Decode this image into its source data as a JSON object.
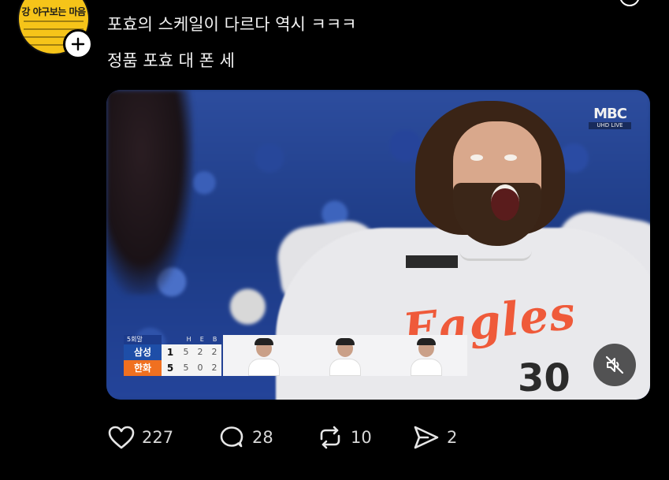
{
  "post": {
    "text_line1": "포효의 스케일이 다르다 역시 ㅋㅋㅋ",
    "text_line2": "정품 포효 대 폰 세"
  },
  "author": {
    "avatar_text": "강 야구보는 마음"
  },
  "media": {
    "broadcaster": "MBC",
    "broadcaster_sub": "UHD LIVE",
    "jersey_wordmark": "Eagles",
    "jersey_number": "30",
    "scoreboard": {
      "inning": "5회말",
      "stat_headers": [
        "H",
        "E",
        "B"
      ],
      "teams": [
        {
          "name": "삼성",
          "runs": "1",
          "stats": [
            "5",
            "2",
            "2"
          ]
        },
        {
          "name": "한화",
          "runs": "5",
          "stats": [
            "5",
            "0",
            "2"
          ]
        }
      ]
    },
    "muted": true
  },
  "actions": {
    "likes": "227",
    "comments": "28",
    "reposts": "10",
    "shares": "2"
  },
  "colors": {
    "background": "#000000",
    "home_team": "#1e4ea8",
    "away_team": "#f07020",
    "jersey_accent": "#ef5a3a"
  },
  "icons": {
    "follow": "plus-icon",
    "mute": "speaker-muted-icon",
    "like": "heart-icon",
    "comment": "speech-bubble-icon",
    "repost": "repost-arrows-icon",
    "share": "send-icon",
    "more": "more-options-icon"
  }
}
